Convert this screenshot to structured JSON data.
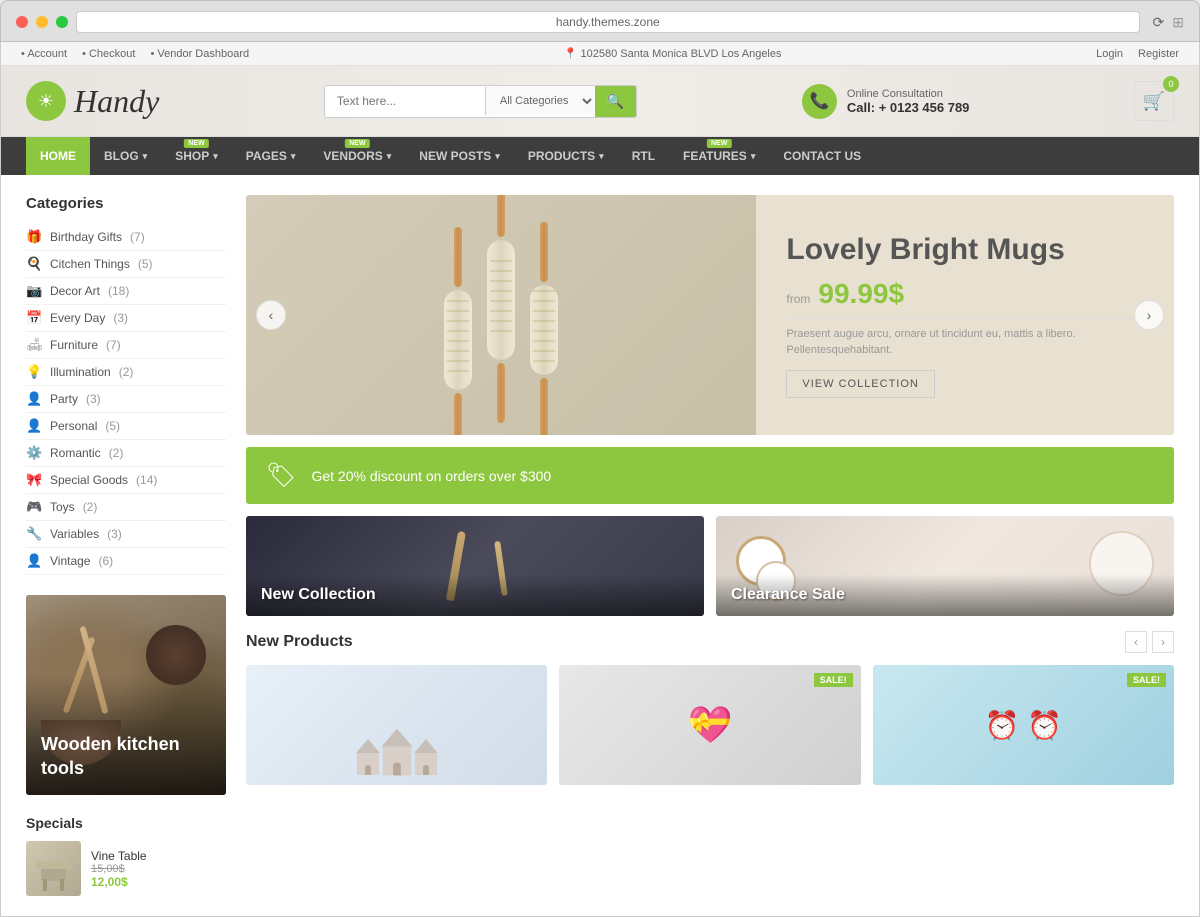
{
  "browser": {
    "url": "handy.themes.zone",
    "reload_label": "⟳"
  },
  "topbar": {
    "links": [
      "Account",
      "Checkout",
      "Vendor Dashboard"
    ],
    "address": "102580 Santa Monica BLVD Los Angeles",
    "login": "Login",
    "register": "Register"
  },
  "header": {
    "logo_text": "Handy",
    "search_placeholder": "Text here...",
    "search_category": "All Categories",
    "phone_label": "Online Consultation",
    "phone_number": "Call: + 0123 456 789",
    "cart_count": "0"
  },
  "nav": {
    "items": [
      {
        "label": "HOME",
        "active": true,
        "badge": null
      },
      {
        "label": "BLOG",
        "active": false,
        "badge": null,
        "arrow": true
      },
      {
        "label": "SHOP",
        "active": false,
        "badge": "NEW",
        "arrow": true
      },
      {
        "label": "PAGES",
        "active": false,
        "badge": null,
        "arrow": true
      },
      {
        "label": "VENDORS",
        "active": false,
        "badge": "NEW",
        "arrow": true
      },
      {
        "label": "NEW POSTS",
        "active": false,
        "badge": null,
        "arrow": true
      },
      {
        "label": "PRODUCTS",
        "active": false,
        "badge": null,
        "arrow": true
      },
      {
        "label": "RTL",
        "active": false,
        "badge": null
      },
      {
        "label": "FEATURES",
        "active": false,
        "badge": "NEW",
        "arrow": true
      },
      {
        "label": "CONTACT US",
        "active": false,
        "badge": null
      }
    ]
  },
  "sidebar": {
    "categories_title": "Categories",
    "categories": [
      {
        "name": "Birthday Gifts",
        "count": 7,
        "icon": "🎁"
      },
      {
        "name": "Citchen Things",
        "count": 5,
        "icon": "🍳"
      },
      {
        "name": "Decor Art",
        "count": 18,
        "icon": "📷"
      },
      {
        "name": "Every Day",
        "count": 3,
        "icon": "📅"
      },
      {
        "name": "Furniture",
        "count": 7,
        "icon": "🛋"
      },
      {
        "name": "Illumination",
        "count": 2,
        "icon": "💡"
      },
      {
        "name": "Party",
        "count": 3,
        "icon": "👤"
      },
      {
        "name": "Personal",
        "count": 5,
        "icon": "👤"
      },
      {
        "name": "Romantic",
        "count": 2,
        "icon": "⚙️"
      },
      {
        "name": "Special Goods",
        "count": 14,
        "icon": "🎀"
      },
      {
        "name": "Toys",
        "count": 2,
        "icon": "🎮"
      },
      {
        "name": "Variables",
        "count": 3,
        "icon": "🔧"
      },
      {
        "name": "Vintage",
        "count": 6,
        "icon": "👤"
      }
    ],
    "banner_text": "Wooden kitchen tools",
    "specials_title": "Specials",
    "special_item": {
      "name": "Vine Table",
      "old_price": "15,00$",
      "new_price": "12,00$"
    }
  },
  "hero": {
    "subtitle": "",
    "title": "Lovely Bright Mugs",
    "from_label": "from",
    "price": "99.99$",
    "description": "Praesent augue arcu, ornare ut tincidunt eu, mattis a libero. Pellentesquehabitant.",
    "button_label": "VIEW COLLECTION"
  },
  "discount_banner": {
    "text": "Get 20% discount on orders over $300"
  },
  "promo": {
    "new_collection_label": "New Collection",
    "clearance_label": "Clearance Sale"
  },
  "new_products": {
    "title": "New Products",
    "sale_badge": "SALE!",
    "products": [
      {
        "id": 1,
        "has_sale": false
      },
      {
        "id": 2,
        "has_sale": true
      },
      {
        "id": 3,
        "has_sale": true
      }
    ]
  }
}
